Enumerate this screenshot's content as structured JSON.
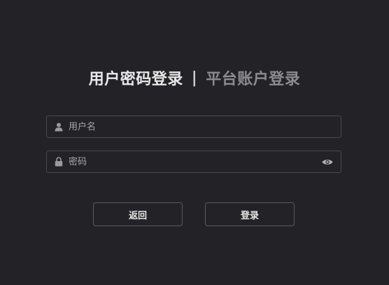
{
  "tabs": {
    "active_label": "用户密码登录",
    "separator": "|",
    "inactive_label": "平台账户登录"
  },
  "form": {
    "username": {
      "placeholder": "用户名",
      "value": "",
      "icon": "user-icon"
    },
    "password": {
      "placeholder": "密码",
      "value": "",
      "icon": "lock-icon",
      "toggle_icon": "eye-icon"
    }
  },
  "buttons": {
    "back_label": "返回",
    "login_label": "登录"
  },
  "colors": {
    "background": "#232226",
    "border": "#4a4a4e",
    "text_active": "#e9e9e9",
    "text_inactive": "#8c8c8e"
  }
}
